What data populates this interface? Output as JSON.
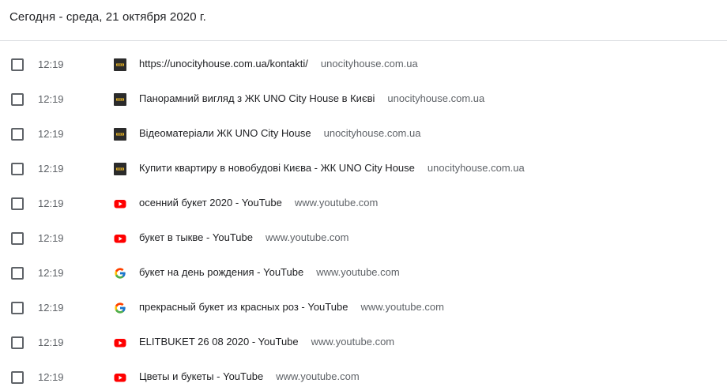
{
  "header": {
    "date_label": "Сегодня - среда, 21 октября 2020 г."
  },
  "entries": [
    {
      "time": "12:19",
      "icon": "uno-city-house-favicon-icon",
      "title": "https://unocityhouse.com.ua/kontakti/",
      "domain": "unocityhouse.com.ua"
    },
    {
      "time": "12:19",
      "icon": "uno-city-house-favicon-icon",
      "title": "Панорамний вигляд з ЖК UNO City House в Києві",
      "domain": "unocityhouse.com.ua"
    },
    {
      "time": "12:19",
      "icon": "uno-city-house-favicon-icon",
      "title": "Відеоматеріали ЖК UNO City House",
      "domain": "unocityhouse.com.ua"
    },
    {
      "time": "12:19",
      "icon": "uno-city-house-favicon-icon",
      "title": "Купити квартиру в новобудові Києва - ЖК UNO City House",
      "domain": "unocityhouse.com.ua"
    },
    {
      "time": "12:19",
      "icon": "youtube-favicon-icon",
      "title": "осенний букет 2020 - YouTube",
      "domain": "www.youtube.com"
    },
    {
      "time": "12:19",
      "icon": "youtube-favicon-icon",
      "title": "букет в тыкве - YouTube",
      "domain": "www.youtube.com"
    },
    {
      "time": "12:19",
      "icon": "google-favicon-icon",
      "title": "букет на день рождения - YouTube",
      "domain": "www.youtube.com"
    },
    {
      "time": "12:19",
      "icon": "google-favicon-icon",
      "title": "прекрасный букет из красных роз - YouTube",
      "domain": "www.youtube.com"
    },
    {
      "time": "12:19",
      "icon": "youtube-favicon-icon",
      "title": "ELITBUKET 26 08 2020 - YouTube",
      "domain": "www.youtube.com"
    },
    {
      "time": "12:19",
      "icon": "youtube-favicon-icon",
      "title": "Цветы и букеты - YouTube",
      "domain": "www.youtube.com"
    }
  ],
  "colors": {
    "text_primary": "#202124",
    "text_secondary": "#5f6368",
    "divider": "#dadce0",
    "youtube_red": "#ff0000",
    "uno_favicon_bg": "#2b2b2b",
    "uno_favicon_accent": "#e6b325"
  }
}
